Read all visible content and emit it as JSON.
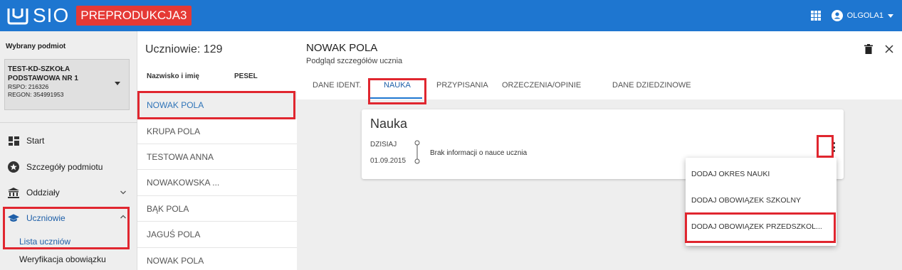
{
  "app": {
    "logo_text": "SIO",
    "environment_badge": "PREPRODUKCJA3",
    "brand_color": "#1e76d0",
    "badge_color": "#e53935"
  },
  "topbar": {
    "apps_icon": "grid-apps-icon",
    "user_icon": "account-circle-icon",
    "user_name": "OLGOLA1"
  },
  "sidebar": {
    "selected_label": "Wybrany podmiot",
    "entity": {
      "name": "TEST-KD-SZKOŁA PODSTAWOWA NR 1",
      "rspo": "RSPO: 216326",
      "regon": "REGON: 354991953"
    },
    "nav": [
      {
        "label": "Start",
        "icon": "dashboard-icon"
      },
      {
        "label": "Szczegóły podmiotu",
        "icon": "star-badge-icon"
      },
      {
        "label": "Oddziały",
        "icon": "institution-icon"
      },
      {
        "label": "Uczniowie",
        "icon": "graduation-cap-icon"
      }
    ],
    "sub_items": [
      "Lista uczniów",
      "Weryfikacja obowiązku"
    ]
  },
  "students": {
    "title": "Uczniowie: 129",
    "columns": [
      "Nazwisko i imię",
      "PESEL"
    ],
    "rows": [
      "NOWAK POLA",
      "KRUPA POLA",
      "TESTOWA ANNA",
      "NOWAKOWSKA ...",
      "BĄK POLA",
      "JAGUŚ POLA",
      "NOWAK POLA"
    ]
  },
  "detail": {
    "title": "NOWAK POLA",
    "subtitle": "Podgląd szczegółów ucznia",
    "tabs": [
      "DANE IDENT.",
      "NAUKA",
      "PRZYPISANIA",
      "ORZECZENIA/OPINIE",
      "DANE DZIEDZINOWE"
    ],
    "active_tab": "NAUKA",
    "card": {
      "title": "Nauka",
      "timeline_now": "DZISIAJ",
      "timeline_date": "01.09.2015",
      "timeline_text": "Brak informacji o nauce ucznia"
    },
    "menu": [
      "DODAJ OKRES NAUKI",
      "DODAJ OBOWIĄZEK SZKOLNY",
      "DODAJ OBOWIĄZEK PRZEDSZKOL..."
    ]
  },
  "highlight_color": "#e0262f"
}
